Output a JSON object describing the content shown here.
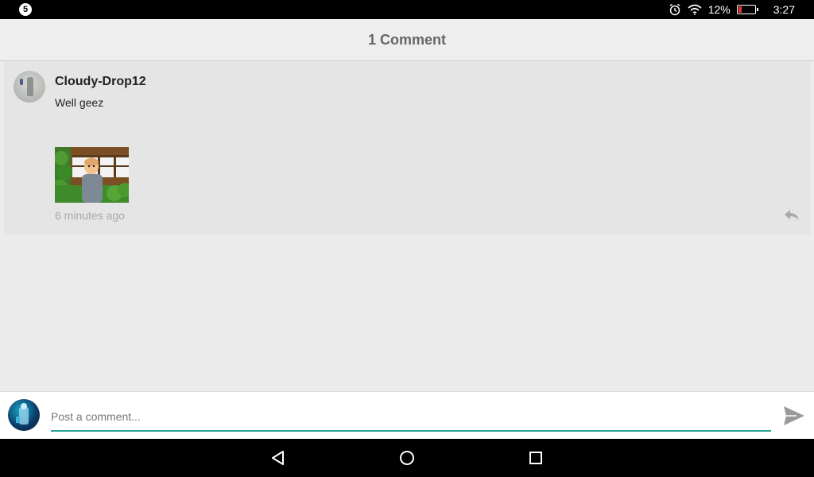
{
  "status_bar": {
    "notification_count": "5",
    "battery_percent": "12%",
    "time": "3:27",
    "icons": [
      "alarm-icon",
      "wifi-icon",
      "battery-icon"
    ]
  },
  "app_bar": {
    "title": "1 Comment"
  },
  "comments": [
    {
      "username": "Cloudy-Drop12",
      "text": "Well geez",
      "timestamp": "6 minutes ago",
      "has_image": true,
      "reply_icon": "reply-icon"
    }
  ],
  "composer": {
    "placeholder": "Post a comment...",
    "value": "",
    "send_icon": "send-icon"
  },
  "nav_bar": {
    "icons": [
      "back-icon",
      "home-icon",
      "recents-icon"
    ]
  },
  "colors": {
    "accent": "#2aa198",
    "status_bar_bg": "#000000",
    "battery_low": "#e53935"
  }
}
